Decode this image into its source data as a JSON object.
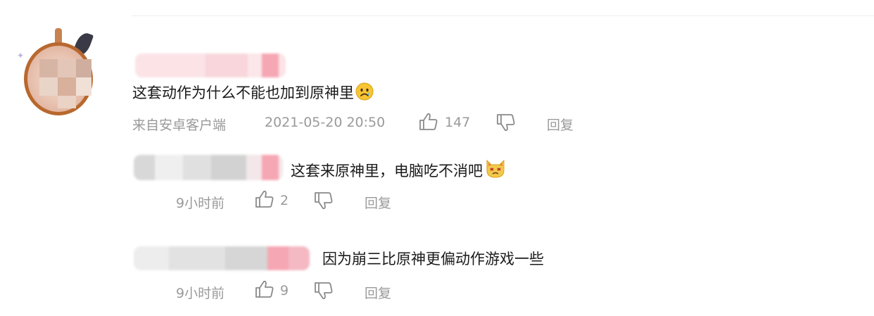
{
  "comment": {
    "text": "这套动作为什么不能也加到原神里",
    "emoji": "sad-face",
    "source": "来自安卓客户端",
    "time": "2021-05-20 20:50",
    "likes": "147",
    "reply_label": "回复"
  },
  "replies": [
    {
      "text": "这套来原神里，电脑吃不消吧",
      "emoji": "cat-face",
      "time": "9小时前",
      "likes": "2",
      "reply_label": "回复"
    },
    {
      "text": "因为崩三比原神更偏动作游戏一些",
      "time": "9小时前",
      "likes": "9",
      "reply_label": "回复"
    }
  ],
  "colors": {
    "text": "#1a1a1a",
    "meta": "#9a9a9a",
    "blur_pink": "#f6a7b4"
  }
}
